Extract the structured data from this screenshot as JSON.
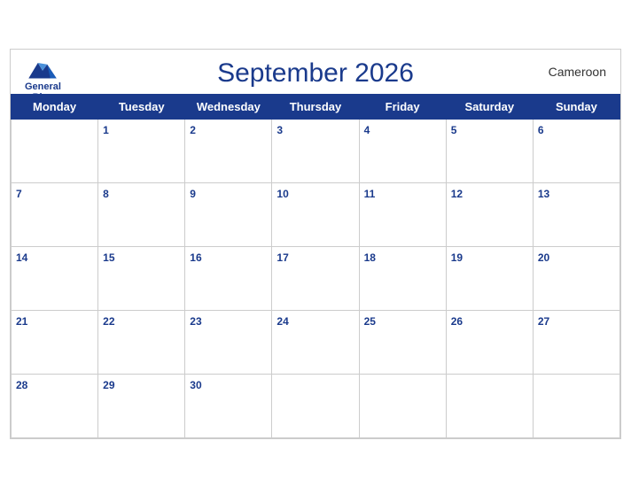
{
  "header": {
    "logo_general": "General",
    "logo_blue": "Blue",
    "title": "September 2026",
    "country": "Cameroon"
  },
  "weekdays": [
    "Monday",
    "Tuesday",
    "Wednesday",
    "Thursday",
    "Friday",
    "Saturday",
    "Sunday"
  ],
  "weeks": [
    [
      null,
      1,
      2,
      3,
      4,
      5,
      6
    ],
    [
      7,
      8,
      9,
      10,
      11,
      12,
      13
    ],
    [
      14,
      15,
      16,
      17,
      18,
      19,
      20
    ],
    [
      21,
      22,
      23,
      24,
      25,
      26,
      27
    ],
    [
      28,
      29,
      30,
      null,
      null,
      null,
      null
    ]
  ]
}
